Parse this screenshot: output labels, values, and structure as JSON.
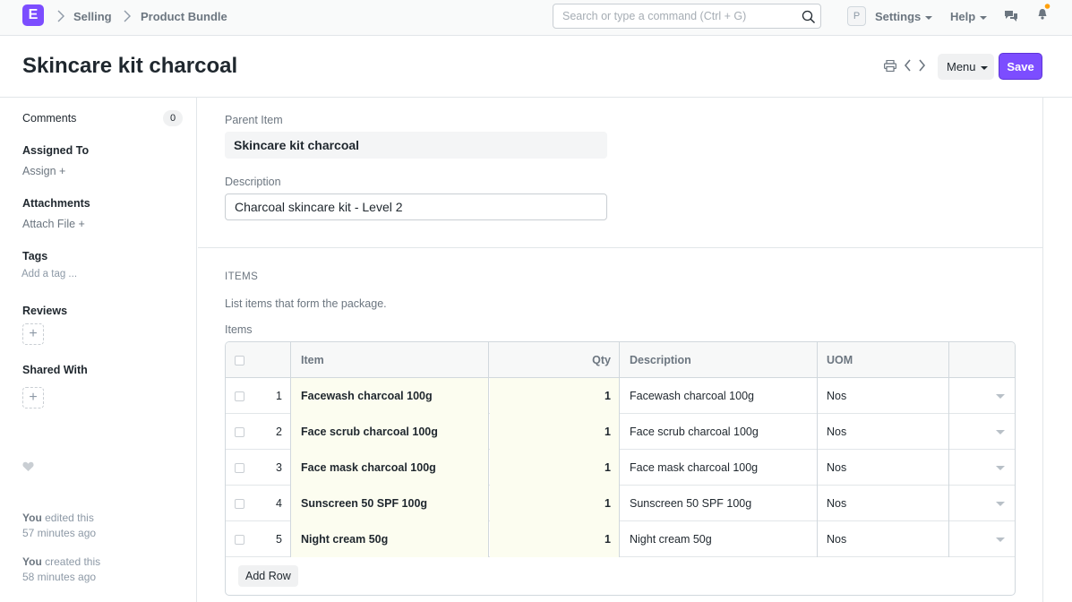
{
  "navbar": {
    "logo": "E",
    "breadcrumbs": [
      "Selling",
      "Product Bundle"
    ],
    "search_placeholder": "Search or type a command (Ctrl + G)",
    "avatar_letter": "P",
    "settings_label": "Settings",
    "help_label": "Help"
  },
  "page": {
    "title": "Skincare kit charcoal",
    "menu_label": "Menu",
    "save_label": "Save"
  },
  "sidebar": {
    "comments_label": "Comments",
    "comments_count": "0",
    "assigned_to_label": "Assigned To",
    "assign_link": "Assign",
    "attachments_label": "Attachments",
    "attach_file_link": "Attach File",
    "tags_label": "Tags",
    "add_tag_link": "Add a tag ...",
    "reviews_label": "Reviews",
    "shared_with_label": "Shared With",
    "activity": [
      {
        "who": "You",
        "action": " edited this",
        "when": "57 minutes ago"
      },
      {
        "who": "You",
        "action": " created this",
        "when": "58 minutes ago"
      }
    ]
  },
  "form": {
    "parent_item_label": "Parent Item",
    "parent_item_value": "Skincare kit charcoal",
    "description_label": "Description",
    "description_value": "Charcoal skincare kit - Level 2",
    "section_title": "ITEMS",
    "section_description": "List items that form the package.",
    "items_label": "Items"
  },
  "grid": {
    "columns": [
      "Item",
      "Qty",
      "Description",
      "UOM"
    ],
    "rows": [
      {
        "no": "1",
        "item": "Facewash charcoal 100g",
        "qty": "1",
        "description": "Facewash charcoal 100g",
        "uom": "Nos"
      },
      {
        "no": "2",
        "item": "Face scrub charcoal 100g",
        "qty": "1",
        "description": "Face scrub charcoal 100g",
        "uom": "Nos"
      },
      {
        "no": "3",
        "item": "Face mask charcoal 100g",
        "qty": "1",
        "description": "Face mask charcoal 100g",
        "uom": "Nos"
      },
      {
        "no": "4",
        "item": "Sunscreen 50 SPF 100g",
        "qty": "1",
        "description": "Sunscreen 50 SPF 100g",
        "uom": "Nos"
      },
      {
        "no": "5",
        "item": "Night cream 50g",
        "qty": "1",
        "description": "Night cream 50g",
        "uom": "Nos"
      }
    ],
    "add_row_label": "Add Row"
  },
  "colors": {
    "accent": "#7c4dff",
    "notification_dot": "#ffa00a"
  }
}
